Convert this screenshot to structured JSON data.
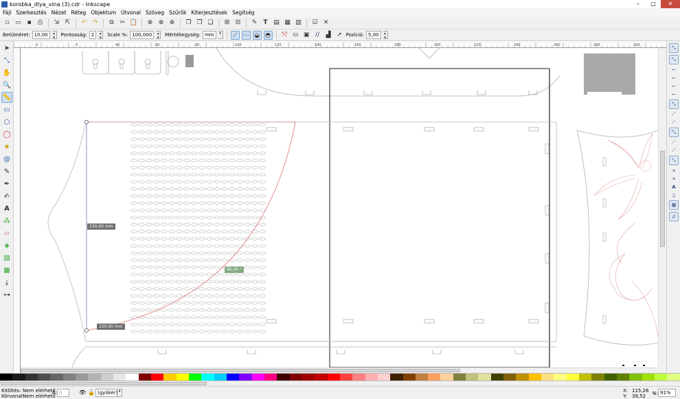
{
  "window": {
    "title": "korobka_dlya_vina (3).cdr - Inkscape"
  },
  "menu": [
    "Fájl",
    "Szerkesztés",
    "Nézet",
    "Réteg",
    "Objektum",
    "Útvonal",
    "Szöveg",
    "Szűrők",
    "Kiterjesztések",
    "Segítség"
  ],
  "controls": {
    "font_size_label": "Betűméret:",
    "font_size_value": "10,00",
    "precision_label": "Pontosság:",
    "precision_value": "2",
    "scale_label": "Scale %:",
    "scale_value": "100,000",
    "unit_label": "Mértékegység:",
    "unit_value": "mm",
    "position_label": "Pozíció:",
    "position_value": "5,00"
  },
  "ruler": {
    "h_ticks": [
      "0",
      "0",
      "40",
      "60",
      "80",
      "100",
      "120",
      "140",
      "160",
      "180",
      "200",
      "220",
      "240",
      "260",
      "280",
      "300"
    ]
  },
  "measure": {
    "len1": "150,00 mm",
    "len2": "150,00 mm",
    "angle": "90,00 °"
  },
  "status": {
    "fill_label": "Kitöltés:",
    "fill_value": "Nem elérhető",
    "stroke_label": "Körvonal:",
    "stroke_value": "Nem elérhető",
    "opacity_label": "Á:",
    "opacity_value": "0",
    "layer_value": "(gyökér)",
    "x_label": "X:",
    "x_value": "115,26",
    "y_label": "Y:",
    "y_value": "39,52",
    "zoom_label": "N:",
    "zoom_value": "91%"
  },
  "palette": [
    "#000000",
    "#1a1a1a",
    "#333333",
    "#4d4d4d",
    "#666666",
    "#808080",
    "#999999",
    "#b3b3b3",
    "#cccccc",
    "#e6e6e6",
    "#ffffff",
    "#800000",
    "#ff0000",
    "#ffcc00",
    "#ffff00",
    "#00ff00",
    "#00ffff",
    "#00ccff",
    "#0000ff",
    "#8000ff",
    "#ff00ff",
    "#ff0080",
    "#400000",
    "#800000",
    "#a00000",
    "#c00000",
    "#ff0000",
    "#ff4040",
    "#ff8080",
    "#ffb0b0",
    "#ffd0d0",
    "#402000",
    "#804000",
    "#c08040",
    "#ffa060",
    "#ffd0a0",
    "#808040",
    "#c0c080",
    "#e0e0a0",
    "#404000",
    "#806000",
    "#c09000",
    "#ffc000",
    "#ffe080",
    "#ffff80",
    "#ffff40",
    "#c0c000",
    "#808000",
    "#406000",
    "#608000",
    "#80c000",
    "#a0e000",
    "#c0ff40",
    "#e0ff80"
  ],
  "colors": {
    "measure_red": "#e08080",
    "measure_blue": "#7070c0",
    "shape_grey": "#b0b0b0"
  }
}
